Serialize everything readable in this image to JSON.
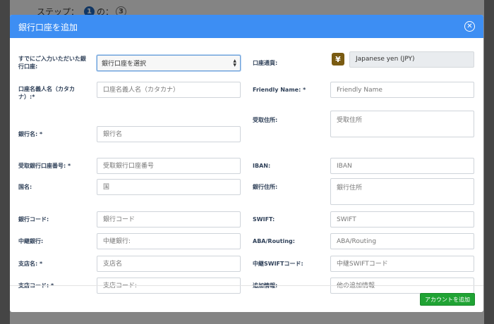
{
  "steps": {
    "label": "ステップ：",
    "current": "1",
    "separator": "の：",
    "total": "3"
  },
  "modal": {
    "title": "銀行口座を追加",
    "close_icon": "close-circle-icon"
  },
  "left": {
    "saved_account": {
      "label": "すでにご入力いただいた銀行口座:",
      "value": "銀行口座を選択"
    },
    "holder_kana": {
      "label": "口座名義人名（カタカナ）:*",
      "placeholder": "口座名義人名（カタカナ）"
    },
    "bank_name": {
      "label": "銀行名: *",
      "placeholder": "銀行名"
    },
    "account_number": {
      "label": "受取銀行口座番号: *",
      "placeholder": "受取銀行口座番号"
    },
    "country": {
      "label": "国名:",
      "placeholder": "国"
    },
    "bank_code": {
      "label": "銀行コード:",
      "placeholder": "銀行コード"
    },
    "intermediary": {
      "label": "中継銀行:",
      "placeholder": "中継銀行:"
    },
    "branch_name": {
      "label": "支店名: *",
      "placeholder": "支店名"
    },
    "branch_code": {
      "label": "支店コード: *",
      "placeholder": "支店コード:"
    }
  },
  "right": {
    "currency": {
      "label": "口座通貨:",
      "value": "Japanese yen (JPY)",
      "icon_text": "¥"
    },
    "friendly_name": {
      "label": "Friendly Name: *",
      "placeholder": "Friendly Name"
    },
    "recipient_address": {
      "label": "受取住所:",
      "placeholder": "受取住所"
    },
    "iban": {
      "label": "IBAN:",
      "placeholder": "IBAN"
    },
    "bank_address": {
      "label": "銀行住所:",
      "placeholder": "銀行住所"
    },
    "swift": {
      "label": "SWIFT:",
      "placeholder": "SWIFT"
    },
    "aba": {
      "label": "ABA/Routing:",
      "placeholder": "ABA/Routing"
    },
    "intermediary_swift": {
      "label": "中継SWIFTコード:",
      "placeholder": "中継SWIFTコード"
    },
    "additional_info": {
      "label": "追加情報:",
      "placeholder": "他の追加情報"
    }
  },
  "footer": {
    "submit_label": "アカウントを追加"
  }
}
